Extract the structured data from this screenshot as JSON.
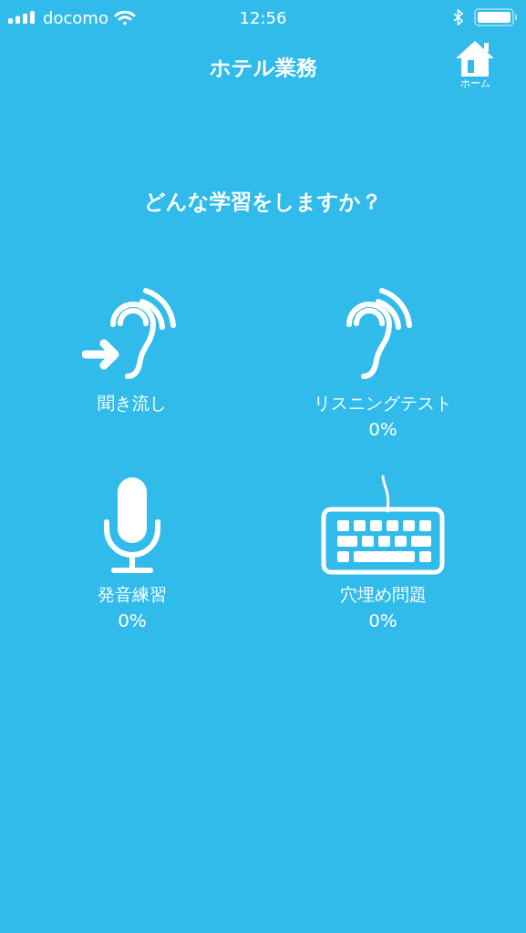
{
  "status_bar": {
    "carrier": "docomo",
    "time": "12:56"
  },
  "nav": {
    "title": "ホテル業務",
    "home_label": "ホーム"
  },
  "question": "どんな学習をしますか？",
  "modes": [
    {
      "kind": "listen",
      "label": "聞き流し"
    },
    {
      "kind": "test",
      "label": "リスニングテスト",
      "progress": "0%"
    },
    {
      "kind": "speak",
      "label": "発音練習",
      "progress": "0%"
    },
    {
      "kind": "type",
      "label": "穴埋め問題",
      "progress": "0%"
    }
  ]
}
